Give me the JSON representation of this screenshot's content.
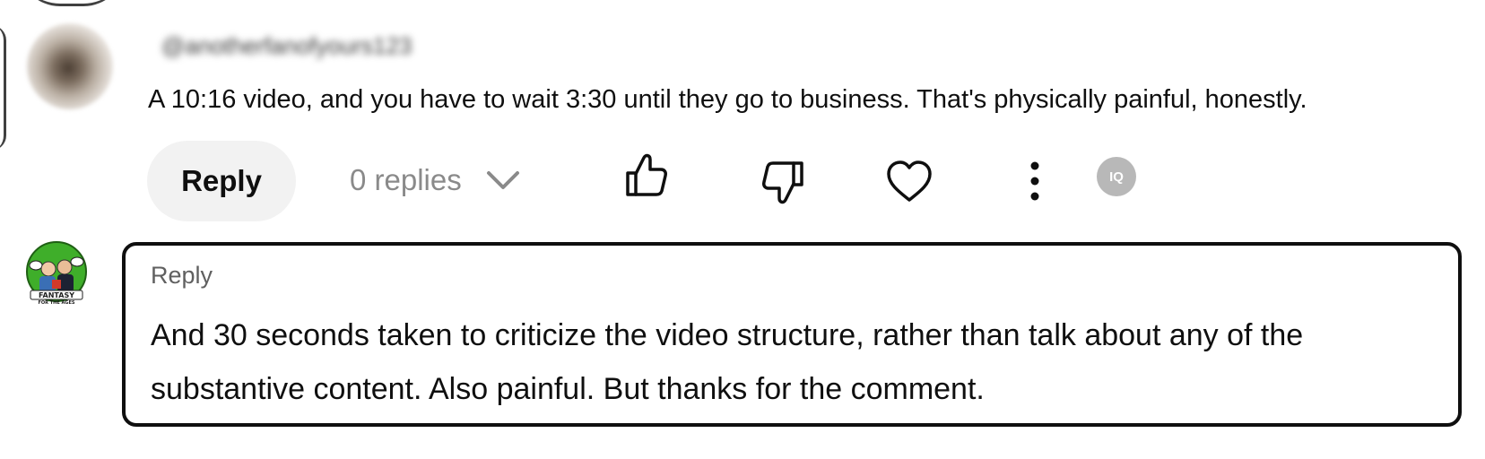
{
  "comment": {
    "author": "@anotherfanofyours123",
    "text": "A 10:16 video, and you have to wait 3:30 until they go to business. That's physically painful, honestly.",
    "reply_label": "Reply",
    "replies_label": "0 replies",
    "actions": {
      "like_icon": "thumbs-up-icon",
      "dislike_icon": "thumbs-down-icon",
      "heart_icon": "heart-icon",
      "more_icon": "more-vert-icon"
    },
    "extension_badge": "IQ"
  },
  "reply_box": {
    "label": "Reply",
    "text": "And 30 seconds taken to criticize the video structure, rather than talk about any of the substantive content. Also painful. But thanks for the comment."
  },
  "user_avatar": {
    "logo_text_main": "FANTASY",
    "logo_text_sub": "FOR THE AGES",
    "background_color": "#3fae2a"
  },
  "colors": {
    "text_primary": "#0f0f0f",
    "text_secondary": "#606060",
    "muted": "#8a8a8a",
    "button_bg": "#f2f2f2",
    "border": "#0f0f0f"
  }
}
